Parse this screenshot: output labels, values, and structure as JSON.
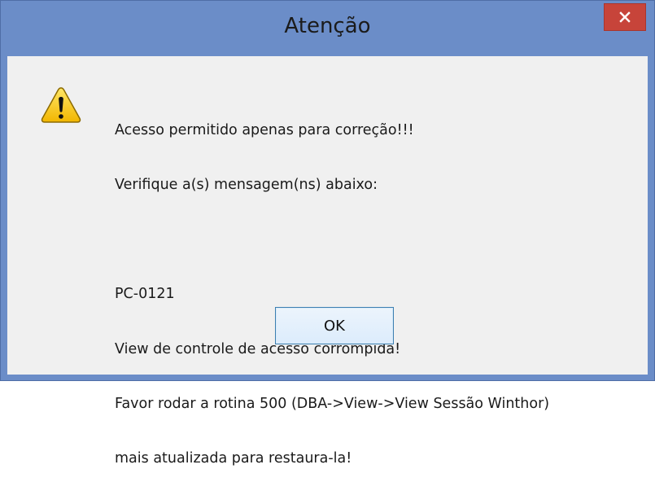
{
  "window": {
    "title": "Atenção",
    "close_icon": "close-icon"
  },
  "dialog": {
    "icon": "warning-icon",
    "message_lines": [
      "Acesso permitido apenas para correção!!!",
      "Verifique a(s) mensagem(ns) abaixo:",
      "",
      "PC-0121",
      "View de controle de acesso corrompida!",
      "Favor rodar a rotina 500 (DBA->View->View Sessão Winthor)",
      "mais atualizada para restaura-la!"
    ],
    "ok_label": "OK"
  },
  "colors": {
    "titlebar": "#6b8dc8",
    "close_button": "#c7443a",
    "client": "#f0f0f0",
    "ok_border": "#3c7fb1"
  }
}
